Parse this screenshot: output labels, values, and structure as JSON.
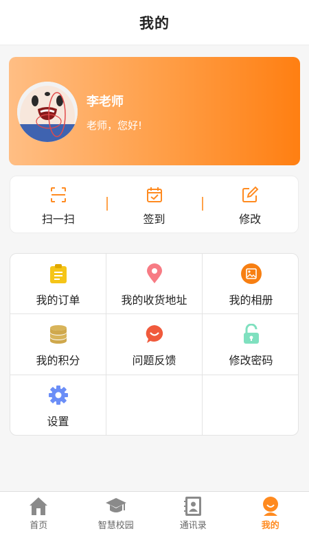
{
  "header": {
    "title": "我的"
  },
  "profile": {
    "name": "李老师",
    "greeting": "老师，您好!"
  },
  "quick_actions": [
    {
      "label": "扫一扫",
      "icon": "scan-icon"
    },
    {
      "label": "签到",
      "icon": "calendar-check-icon"
    },
    {
      "label": "修改",
      "icon": "edit-icon"
    }
  ],
  "menu": [
    {
      "label": "我的订单",
      "icon": "clipboard-icon",
      "color": "#f5c518"
    },
    {
      "label": "我的收货地址",
      "icon": "location-pin-icon",
      "color": "#f77b84"
    },
    {
      "label": "我的相册",
      "icon": "photo-album-icon",
      "color": "#f77f12"
    },
    {
      "label": "我的积分",
      "icon": "coins-stack-icon",
      "color": "#d8b45a"
    },
    {
      "label": "问题反馈",
      "icon": "feedback-chat-icon",
      "color": "#f05a3c"
    },
    {
      "label": "修改密码",
      "icon": "unlock-icon",
      "color": "#7fe0bf"
    },
    {
      "label": "设置",
      "icon": "gear-icon",
      "color": "#6b8ef7"
    }
  ],
  "tabbar": [
    {
      "label": "首页",
      "icon": "home-icon",
      "active": false
    },
    {
      "label": "智慧校园",
      "icon": "graduation-cap-icon",
      "active": false
    },
    {
      "label": "通讯录",
      "icon": "contacts-book-icon",
      "active": false
    },
    {
      "label": "我的",
      "icon": "user-avatar-icon",
      "active": true
    }
  ],
  "colors": {
    "accent": "#ff8a1f",
    "card_gradient_start": "#ffbe84",
    "card_gradient_end": "#ff7f12",
    "inactive_icon": "#8a8a8a"
  }
}
